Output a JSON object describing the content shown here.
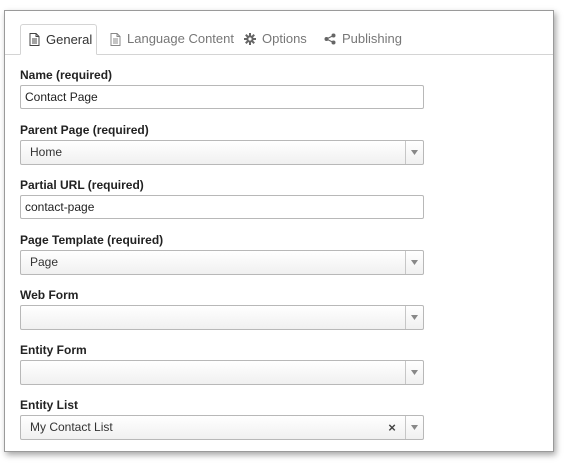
{
  "tabs": [
    {
      "label": "General",
      "icon": "document-icon",
      "active": true
    },
    {
      "label": "Language Content",
      "icon": "document-icon",
      "active": false
    },
    {
      "label": "Options",
      "icon": "gear-icon",
      "active": false
    },
    {
      "label": "Publishing",
      "icon": "share-icon",
      "active": false
    }
  ],
  "form": {
    "name": {
      "label": "Name (required)",
      "value": "Contact Page"
    },
    "parent_page": {
      "label": "Parent Page (required)",
      "value": "Home"
    },
    "partial_url": {
      "label": "Partial URL (required)",
      "value": "contact-page"
    },
    "page_template": {
      "label": "Page Template (required)",
      "value": "Page"
    },
    "web_form": {
      "label": "Web Form",
      "value": ""
    },
    "entity_form": {
      "label": "Entity Form",
      "value": ""
    },
    "entity_list": {
      "label": "Entity List",
      "value": "My Contact List",
      "clear_glyph": "×"
    }
  },
  "colors": {
    "border": "#b8b8b8",
    "tab_border": "#d4d4d4",
    "label": "#222222",
    "muted_tab": "#777777"
  }
}
